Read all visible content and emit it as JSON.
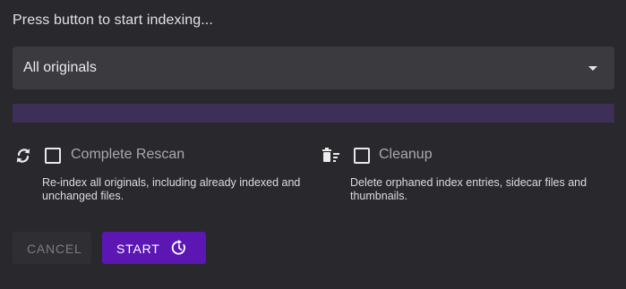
{
  "status_text": "Press button to start indexing...",
  "source_select": {
    "selected": "All originals"
  },
  "progress": {
    "percent": 0
  },
  "options": {
    "rescan": {
      "label": "Complete Rescan",
      "hint_line1": "Re-index all originals, including already indexed and",
      "hint_line2": "unchanged files.",
      "icon": "refresh-icon",
      "checked": false
    },
    "cleanup": {
      "label": "Cleanup",
      "hint_line1": "Delete orphaned index entries, sidecar files and",
      "hint_line2": "thumbnails.",
      "icon": "delete-sweep-icon",
      "checked": false
    }
  },
  "buttons": {
    "cancel_label": "CANCEL",
    "start_label": "START",
    "start_icon": "restart-icon"
  },
  "colors": {
    "background": "#29282c",
    "accent": "#5b16b3",
    "progress_track": "#3d2f57"
  }
}
